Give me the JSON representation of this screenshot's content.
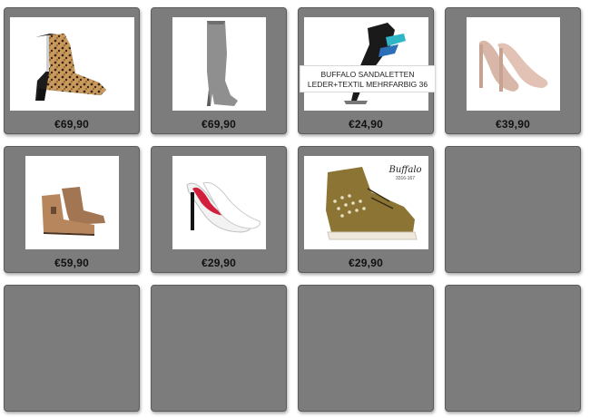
{
  "tiles": [
    {
      "price": "€69,90",
      "product": "leopard-ankle-boot"
    },
    {
      "price": "€69,90",
      "product": "grey-knee-boot"
    },
    {
      "price": "€24,90",
      "product": "multicolor-sandal"
    },
    {
      "price": "€39,90",
      "product": "nude-peep-toe-pump"
    },
    {
      "price": "€59,90",
      "product": "tan-ankle-boots"
    },
    {
      "price": "€29,90",
      "product": "white-platform-pump"
    },
    {
      "price": "€29,90",
      "product": "studded-high-top-sneaker"
    }
  ],
  "tooltip": {
    "line1": "BUFFALO SANDALETTEN",
    "line2": "LEDER+TEXTIL MEHRFARBIG 36"
  },
  "brand_mark": {
    "name": "Buffalo",
    "code": "3316-167"
  },
  "colors": {
    "tile_bg": "#7c7c7c",
    "page_bg": "#ffffff"
  }
}
